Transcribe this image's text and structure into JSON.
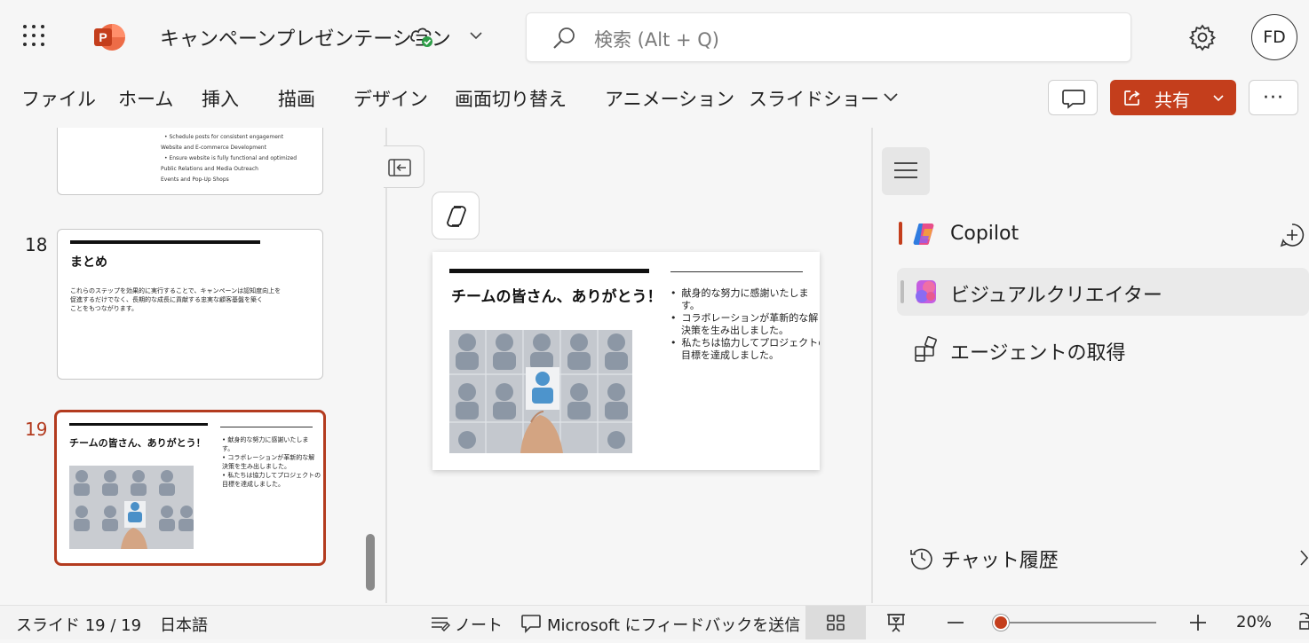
{
  "app": {
    "doc_title": "キャンペーンプレゼンテーション",
    "search_placeholder": "検索 (Alt + Q)",
    "avatar_initials": "FD",
    "logo_letter": "P"
  },
  "ribbon": {
    "tabs": [
      "ファイル",
      "ホーム",
      "挿入",
      "描画",
      "デザイン",
      "画面切り替え",
      "アニメーション",
      "スライドショー"
    ],
    "share_label": "共有"
  },
  "thumbnails": {
    "slide17": {
      "lines": [
        "• Schedule posts for consistent engagement",
        "Website and E-commerce Development",
        "• Ensure website is fully functional and optimized",
        "Public Relations and Media Outreach",
        "Events and Pop-Up Shops"
      ]
    },
    "slide18": {
      "number": "18",
      "title": "まとめ",
      "body_lines": [
        "これらのステップを効果的に実行することで、キャンペーンは認知度向上を",
        "促進するだけでなく、長期的な成長に貢献する忠実な顧客基盤を築く",
        "ことをもつながります。"
      ]
    },
    "slide19": {
      "number": "19",
      "title": "チームの皆さん、ありがとう！",
      "bullets": [
        "• 献身的な努力に感謝いたしま",
        "  す。",
        "• コラボレーションが革新的な解",
        "  決策を生み出しました。",
        "• 私たちは協力してプロジェクトの",
        "  目標を達成しました。"
      ]
    }
  },
  "main_slide": {
    "title": "チームの皆さん、ありがとう！",
    "bullets": [
      "献身的な努力に感謝いたしま",
      "す。",
      "コラボレーションが革新的な解",
      "決策を生み出しました。",
      "私たちは協力してプロジェクトの",
      "目標を達成しました。"
    ]
  },
  "copilot_pane": {
    "copilot_label": "Copilot",
    "visual_creator_label": "ビジュアルクリエイター",
    "agents_label": "エージェントの取得",
    "history_label": "チャット履歴"
  },
  "status": {
    "slide_counter": "スライド 19 / 19",
    "language": "日本語",
    "notes": "ノート",
    "feedback": "Microsoft にフィードバックを送信",
    "zoom_percent": "20%",
    "zoom_fraction": 0.03
  },
  "colors": {
    "accent": "#c43e1c",
    "selected_border": "#b33b1f"
  }
}
